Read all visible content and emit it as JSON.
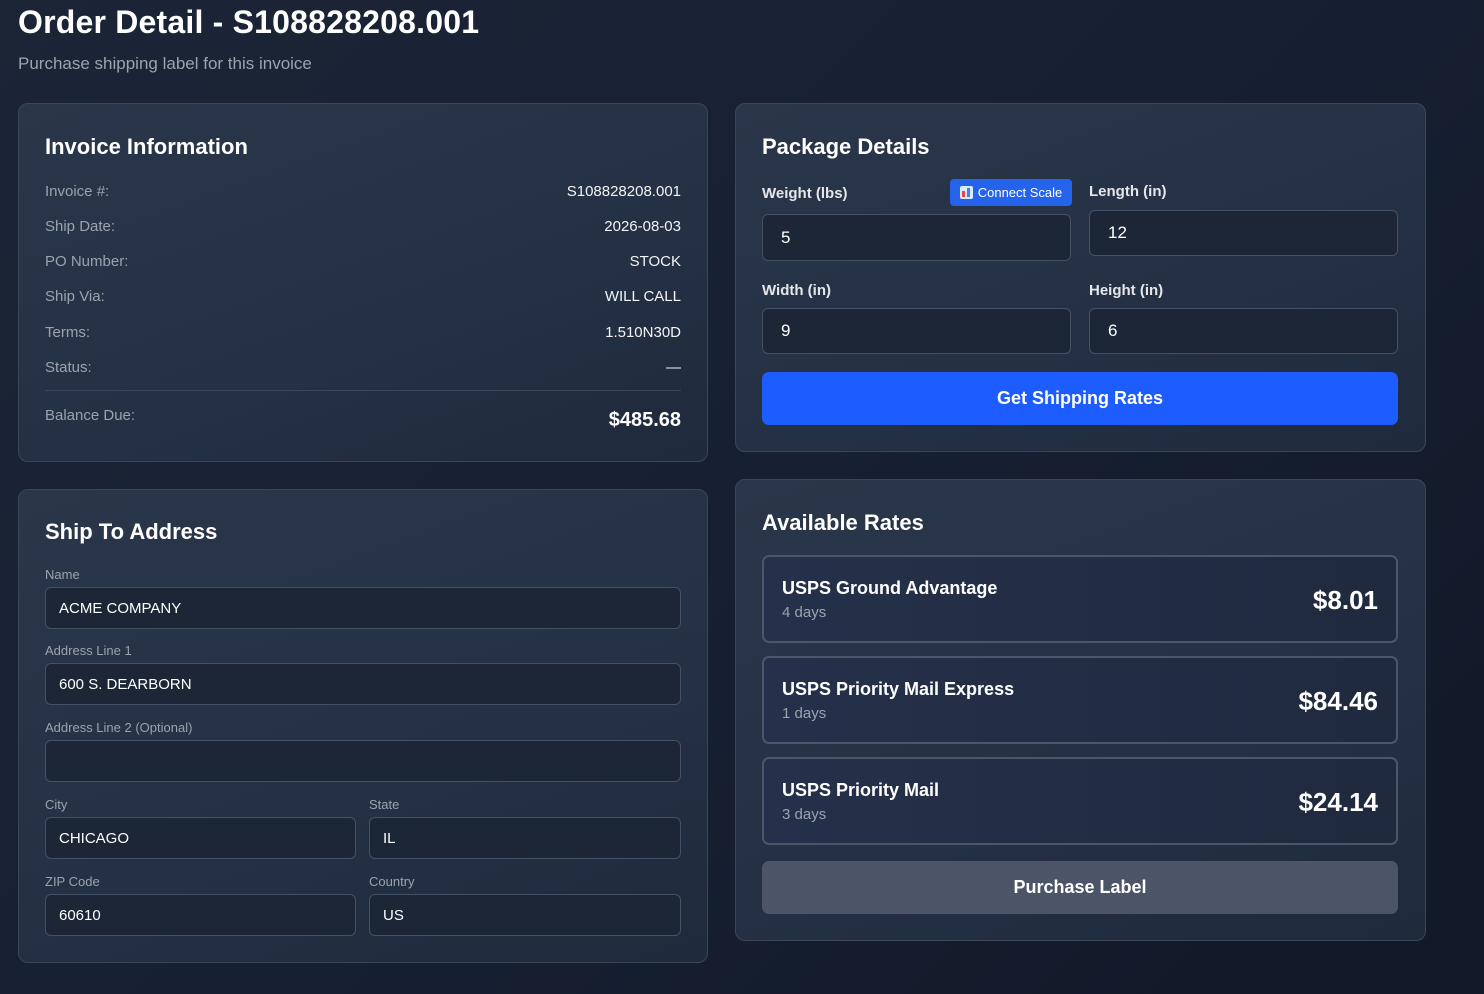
{
  "header": {
    "title": "Order Detail - S108828208.001",
    "subtitle": "Purchase shipping label for this invoice"
  },
  "invoice": {
    "title": "Invoice Information",
    "rows": [
      {
        "label": "Invoice #:",
        "value": "S108828208.001"
      },
      {
        "label": "Ship Date:",
        "value": "2026-08-03"
      },
      {
        "label": "PO Number:",
        "value": "STOCK"
      },
      {
        "label": "Ship Via:",
        "value": "WILL CALL"
      },
      {
        "label": "Terms:",
        "value": "1.510N30D"
      },
      {
        "label": "Status:",
        "value": "—"
      }
    ],
    "balance_label": "Balance Due:",
    "balance_value": "$485.68"
  },
  "ship_to": {
    "title": "Ship To Address",
    "name_label": "Name",
    "name_value": "ACME COMPANY",
    "address1_label": "Address Line 1",
    "address1_value": "600 S. DEARBORN",
    "address2_label": "Address Line 2 (Optional)",
    "address2_value": "",
    "city_label": "City",
    "city_value": "CHICAGO",
    "state_label": "State",
    "state_value": "IL",
    "zip_label": "ZIP Code",
    "zip_value": "60610",
    "country_label": "Country",
    "country_value": "US"
  },
  "package": {
    "title": "Package Details",
    "weight_label": "Weight (lbs)",
    "weight_value": "5",
    "connect_scale_label": "Connect Scale",
    "length_label": "Length (in)",
    "length_value": "12",
    "width_label": "Width (in)",
    "width_value": "9",
    "height_label": "Height (in)",
    "height_value": "6",
    "get_rates_label": "Get Shipping Rates"
  },
  "rates": {
    "title": "Available Rates",
    "options": [
      {
        "name": "USPS Ground Advantage",
        "days": "4 days",
        "price": "$8.01"
      },
      {
        "name": "USPS Priority Mail Express",
        "days": "1 days",
        "price": "$84.46"
      },
      {
        "name": "USPS Priority Mail",
        "days": "3 days",
        "price": "$24.14"
      }
    ],
    "purchase_label": "Purchase Label"
  },
  "colors": {
    "accent": "#1d5cff",
    "background": "#172033",
    "card": "#243044",
    "muted_button": "#4b5567"
  }
}
